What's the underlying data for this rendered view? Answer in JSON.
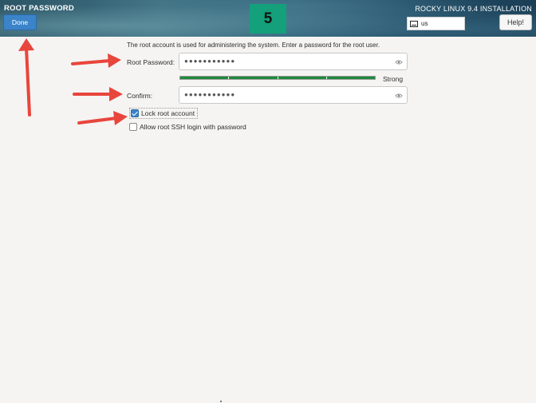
{
  "header": {
    "title": "ROOT PASSWORD",
    "done_label": "Done",
    "step_number": "5",
    "os_title": "ROCKY LINUX 9.4 INSTALLATION",
    "keyboard_layout": "us",
    "help_label": "Help!"
  },
  "form": {
    "description": "The root account is used for administering the system.  Enter a password for the root user.",
    "root_password_label": "Root Password:",
    "root_password_value": "●●●●●●●●●●●",
    "confirm_label": "Confirm:",
    "confirm_value": "●●●●●●●●●●●",
    "strength_label": "Strong",
    "strength_level": 1.0,
    "strength_color": "#1e8a3c",
    "lock_root_label": "Lock root account",
    "lock_root_checked": true,
    "allow_ssh_label": "Allow root SSH login with password",
    "allow_ssh_checked": false
  },
  "colors": {
    "accent": "#3b84c9",
    "step_badge": "#13a07a",
    "annotation_arrow": "#e8453c"
  },
  "icons": {
    "show_password": "eye-icon",
    "keyboard": "keyboard-icon"
  }
}
